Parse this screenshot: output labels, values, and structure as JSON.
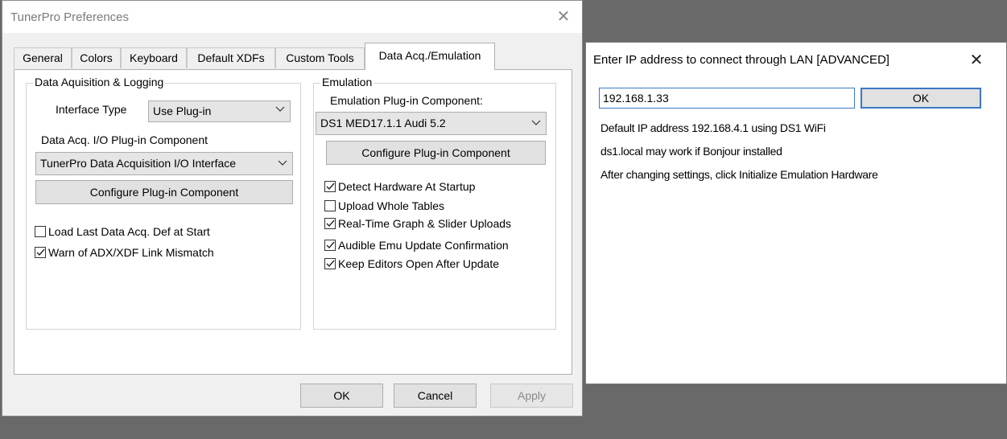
{
  "prefs": {
    "title": "TunerPro Preferences",
    "close": "✕",
    "tabs": [
      {
        "label": "General"
      },
      {
        "label": "Colors"
      },
      {
        "label": "Keyboard"
      },
      {
        "label": "Default XDFs"
      },
      {
        "label": "Custom Tools"
      },
      {
        "label": "Data Acq./Emulation"
      }
    ],
    "daq": {
      "group_title": "Data Aquisition & Logging",
      "interface_type_label": "Interface Type",
      "interface_type_value": "Use Plug-in",
      "plugin_label": "Data Acq. I/O Plug-in Component",
      "plugin_value": "TunerPro Data Acquisition I/O Interface",
      "configure_label": "Configure Plug-in Component",
      "load_last_label": "Load Last Data Acq. Def at Start",
      "load_last_checked": false,
      "warn_label": "Warn of ADX/XDF Link Mismatch",
      "warn_checked": true
    },
    "emu": {
      "group_title": "Emulation",
      "plugin_label": "Emulation Plug-in Component:",
      "plugin_value": "DS1 MED17.1.1 Audi 5.2",
      "configure_label": "Configure Plug-in Component",
      "options": [
        {
          "label": "Detect Hardware At Startup",
          "checked": true
        },
        {
          "label": "Upload Whole Tables",
          "checked": false
        },
        {
          "label": "Real-Time Graph & Slider Uploads",
          "checked": true
        },
        {
          "label": "Audible Emu Update Confirmation",
          "checked": true
        },
        {
          "label": "Keep Editors Open After Update",
          "checked": true
        }
      ]
    },
    "buttons": {
      "ok": "OK",
      "cancel": "Cancel",
      "apply": "Apply"
    }
  },
  "ip_dialog": {
    "title": "Enter IP address to connect through LAN [ADVANCED]",
    "close": "✕",
    "ip_value": "192.168.1.33",
    "ok": "OK",
    "info": [
      "Default IP address 192.168.4.1 using DS1 WiFi",
      "ds1.local may work if Bonjour installed",
      "After changing settings, click Initialize Emulation Hardware"
    ]
  }
}
